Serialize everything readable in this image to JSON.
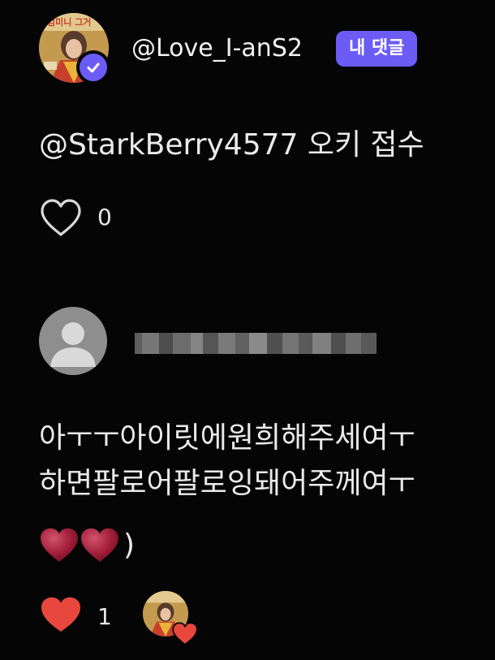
{
  "comments": [
    {
      "author": "@Love_I-anS2",
      "author_badge": "내 댓글",
      "avatar_text": "엄미니 그거",
      "text": "@StarkBerry4577 오키 접수",
      "likes": "0",
      "liked": false
    },
    {
      "author_blurred": true,
      "text_lines": [
        "아ㅜㅜ아이릿에원희해주세여ㅜ",
        "하면팔로어팔로잉돼어주께여ㅜ"
      ],
      "text_tail": ")",
      "likes": "1",
      "liked": true,
      "creator_liked": true
    }
  ],
  "icons": {
    "verified": "verified-check-icon",
    "like_outline": "heart-outline-icon",
    "like_filled": "heart-filled-icon",
    "default_avatar": "default-user-avatar-icon",
    "emoji_heart": "red-heart-emoji"
  },
  "colors": {
    "background": "#050505",
    "accent": "#6b5cf6",
    "like_red": "#e8473d",
    "text": "#eaeaea"
  }
}
